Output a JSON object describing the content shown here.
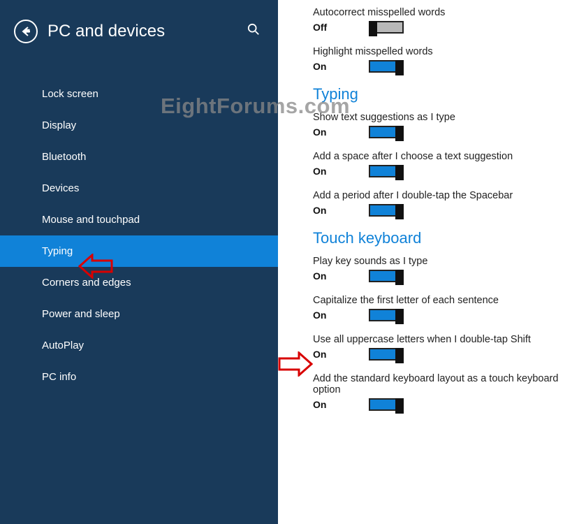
{
  "sidebar": {
    "title": "PC and devices",
    "items": [
      {
        "label": "Lock screen",
        "active": false
      },
      {
        "label": "Display",
        "active": false
      },
      {
        "label": "Bluetooth",
        "active": false
      },
      {
        "label": "Devices",
        "active": false
      },
      {
        "label": "Mouse and touchpad",
        "active": false
      },
      {
        "label": "Typing",
        "active": true
      },
      {
        "label": "Corners and edges",
        "active": false
      },
      {
        "label": "Power and sleep",
        "active": false
      },
      {
        "label": "AutoPlay",
        "active": false
      },
      {
        "label": "PC info",
        "active": false
      }
    ]
  },
  "content": {
    "top_settings": [
      {
        "label": "Autocorrect misspelled words",
        "state": "Off",
        "on": false
      },
      {
        "label": "Highlight misspelled words",
        "state": "On",
        "on": true
      }
    ],
    "sections": [
      {
        "title": "Typing",
        "settings": [
          {
            "label": "Show text suggestions as I type",
            "state": "On",
            "on": true
          },
          {
            "label": "Add a space after I choose a text suggestion",
            "state": "On",
            "on": true
          },
          {
            "label": "Add a period after I double-tap the Spacebar",
            "state": "On",
            "on": true
          }
        ]
      },
      {
        "title": "Touch keyboard",
        "settings": [
          {
            "label": "Play key sounds as I type",
            "state": "On",
            "on": true
          },
          {
            "label": "Capitalize the first letter of each sentence",
            "state": "On",
            "on": true
          },
          {
            "label": "Use all uppercase letters when I double-tap Shift",
            "state": "On",
            "on": true
          },
          {
            "label": "Add the standard keyboard layout as a touch keyboard option",
            "state": "On",
            "on": true
          }
        ]
      }
    ]
  },
  "watermark": "EightForums.com"
}
